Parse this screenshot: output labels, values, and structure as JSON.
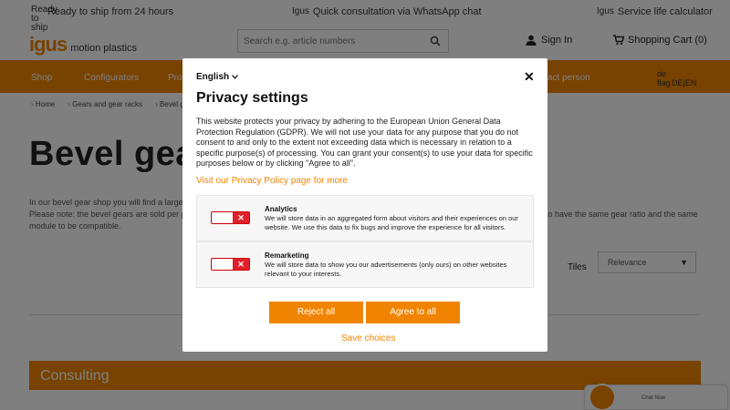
{
  "topbar": {
    "broken_img_alt": "Ready to ship",
    "ship_text": "Ready to ship from 24 hours",
    "whatsapp_img_alt": "Igus",
    "whatsapp_text": "Quick consultation via WhatsApp chat",
    "calc_img_alt": "Igus",
    "calc_text": "Service life calculator"
  },
  "header": {
    "logo_brand": "igus",
    "logo_tagline": "motion plastics",
    "search_placeholder": "Search e.g. article numbers",
    "signin": "Sign In",
    "cart": "Shopping Cart (0)"
  },
  "nav": {
    "items": [
      "Shop",
      "Configurators",
      "Pro",
      "act person"
    ],
    "flag_alt": "de flag",
    "lang": "DE|EN"
  },
  "breadcrumb": [
    "Home",
    "Gears and gear racks",
    "Bevel ge"
  ],
  "page": {
    "title": "Bevel gear",
    "intro_left": "In our bevel gear shop you will find a large a\nPlease note: the bevel gears are sold per pi\nmodule to be compatible.",
    "intro_right": "to have the same gear ratio and the same",
    "tiles_label": "Tiles",
    "sort_value": "Relevance",
    "consulting": "Consulting"
  },
  "chat": {
    "label": "Chat Now"
  },
  "modal": {
    "language": "English",
    "title": "Privacy settings",
    "description": "This website protects your privacy by adhering to the European Union General Data Protection Regulation (GDPR). We will not use your data for any purpose that you do not consent to and only to the extent not exceeding data which is necessary in relation to a specific purpose(s) of processing. You can grant your consent(s) to use your data for specific purposes below or by clicking \"Agree to all\".",
    "policy_link": "Visit our Privacy Policy page for more",
    "options": [
      {
        "title": "Analytics",
        "desc": "We will store data in an aggregated form about visitors and their experiences on our website. We use this data to fix bugs and improve the experience for all visitors."
      },
      {
        "title": "Remarketing",
        "desc": "We will store data to show you our advertisements (only ours) on other websites relevant to your interests."
      }
    ],
    "reject_label": "Reject all",
    "agree_label": "Agree to all",
    "save_label": "Save choices",
    "toggle_symbol": "✕",
    "close_symbol": "✕"
  },
  "colors": {
    "accent": "#f08400",
    "toggle_off": "#e0202a"
  }
}
